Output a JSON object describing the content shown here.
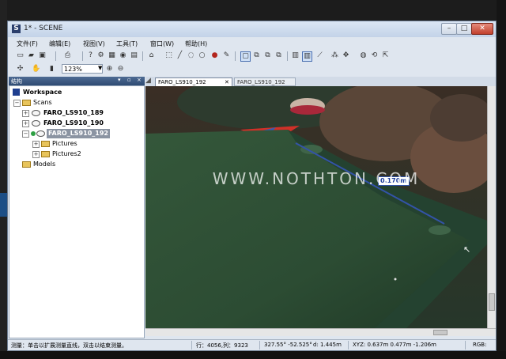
{
  "window": {
    "title": "1* - SCENE",
    "app_icon_letter": "S",
    "controls": {
      "minimize": "–",
      "maximize": "□",
      "close": "✕"
    }
  },
  "menu": [
    "文件(F)",
    "编辑(E)",
    "视图(V)",
    "工具(T)",
    "窗口(W)",
    "帮助(H)"
  ],
  "toolbar": {
    "zoom_value": "123%",
    "row1_icons": [
      "new-icon",
      "open-icon",
      "save-icon",
      "print-icon",
      "help-icon",
      "settings-icon",
      "3d-icon",
      "eye-icon",
      "list-icon",
      "home-icon",
      "select-rect-icon",
      "line-icon",
      "lasso-icon",
      "circle-icon",
      "paint-icon",
      "brush-icon",
      "view-fit-icon",
      "view-1-icon",
      "view-2-icon",
      "view-3-icon",
      "layer-icon",
      "layer-active-icon",
      "measure-icon",
      "points-icon",
      "point-move-icon",
      "zoom-object-icon",
      "rotate-icon",
      "export-icon"
    ],
    "row2_icons": [
      "move-icon",
      "pan-icon",
      "ruler-icon",
      "zoom-in-icon",
      "zoom-out-icon"
    ]
  },
  "panel": {
    "title": "结构",
    "controls": [
      "▾",
      "▫",
      "×"
    ]
  },
  "tree": {
    "workspace": "Workspace",
    "scans": "Scans",
    "scan_1": "FARO_LS910_189",
    "scan_2": "FARO_LS910_190",
    "scan_3": "FARO_LS910_192",
    "pictures": "Pictures",
    "pictures2": "Pictures2",
    "models": "Models"
  },
  "tabs": {
    "active": "FARO_LS910_192",
    "inactive": "FARO_LS910_192",
    "close_glyph": "✕"
  },
  "viewport": {
    "measurement": "0.170m",
    "watermark": "WWW.NOTHTON.COM",
    "cursor_glyph": "↖"
  },
  "status": {
    "hint": "测量：单击以扩展测量直线，双击以结束测量。",
    "row_col": "行：4056,列：9323",
    "angles": "327.55° -52.525°",
    "distance": "d: 1.445m",
    "xyz": "XYZ: 0.637m 0.477m -1.206m",
    "rgb": "RGB:"
  },
  "colors": {
    "selection": "#8b94a2",
    "panel_header": "#2f4b73",
    "measure_line": "#3353a8",
    "close_button": "#c2402c"
  }
}
